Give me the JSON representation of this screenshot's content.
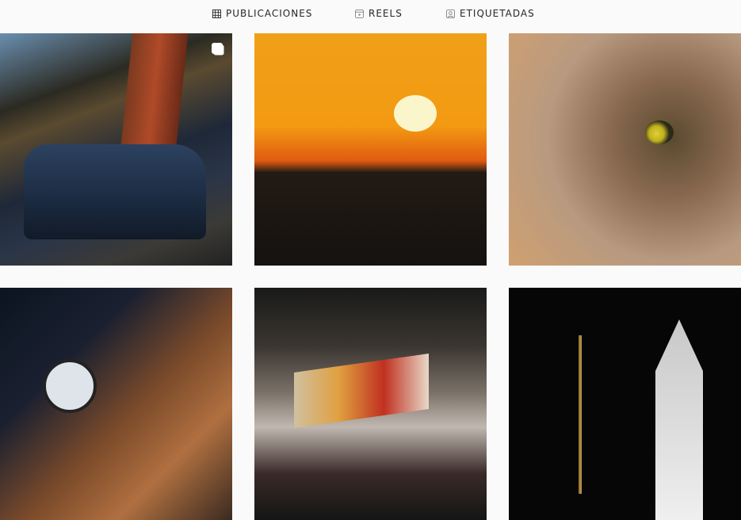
{
  "tabs": [
    {
      "label": "PUBLICACIONES",
      "icon": "grid-icon",
      "active": true
    },
    {
      "label": "REELS",
      "icon": "reels-icon",
      "active": false
    },
    {
      "label": "ETIQUETADAS",
      "icon": "tagged-user-icon",
      "active": false
    }
  ],
  "posts": [
    {
      "subject": "old-truck-under-giant-clothespin",
      "multiple": true
    },
    {
      "subject": "orange-sunset"
    },
    {
      "subject": "yellow-bird-on-sunflower"
    },
    {
      "subject": "street-clock-at-night"
    },
    {
      "subject": "graffiti-train-car"
    },
    {
      "subject": "church-tower-at-night"
    }
  ]
}
